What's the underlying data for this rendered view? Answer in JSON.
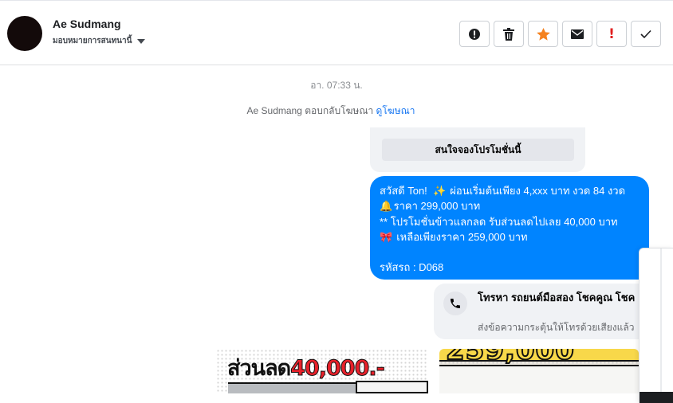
{
  "header": {
    "contact_name": "Ae Sudmang",
    "assign_label": "มอบหมายการสนทนานี้",
    "actions": [
      {
        "name": "spam-button",
        "icon": "exclamation-circle-icon"
      },
      {
        "name": "delete-button",
        "icon": "trash-icon"
      },
      {
        "name": "star-button",
        "icon": "star-icon"
      },
      {
        "name": "mark-unread-button",
        "icon": "envelope-icon"
      },
      {
        "name": "flag-button",
        "icon": "red-exclamation-icon"
      },
      {
        "name": "mark-done-button",
        "icon": "checkmark-icon"
      }
    ]
  },
  "conversation": {
    "timestamp": "อา. 07:33 น.",
    "reply_note": "Ae Sudmang ตอบกลับโฆษณา",
    "reply_link": "ดูโฆษณา",
    "quoted_button": "สนใจจองโปรโมชั่นนี้",
    "message": {
      "line1_a": "สวัสดี Ton!",
      "line1_emoji": "✨",
      "line1_b": "ผ่อนเริ่มต้นเพียง 4,xxx บาท งวด 84 งวด",
      "line2_emoji": "🔔",
      "line2": "ราคา 299,000 บาท",
      "line3": "** โปรโมชั่นข้าวแลกลด รับส่วนลดไปเลย 40,000 บาท",
      "line4_emoji": "🎀",
      "line4": "เหลือเพียงราคา 259,000 บาท",
      "line5": "รหัสรถ : D068"
    },
    "call_card": {
      "title": "โทรหา รถยนต์มือสอง โชคคูณ โชค",
      "subtitle": "ส่งข้อความกระตุ้นให้โทรด้วยเสียงแล้ว"
    },
    "ads": {
      "left_heading": "ส่วนลด",
      "left_amount": "40,000.-",
      "right_price": "259,000"
    }
  },
  "colors": {
    "bubble": "#0084ff",
    "link": "#1877f2",
    "star": "#f5821f",
    "flag": "#e02020"
  }
}
